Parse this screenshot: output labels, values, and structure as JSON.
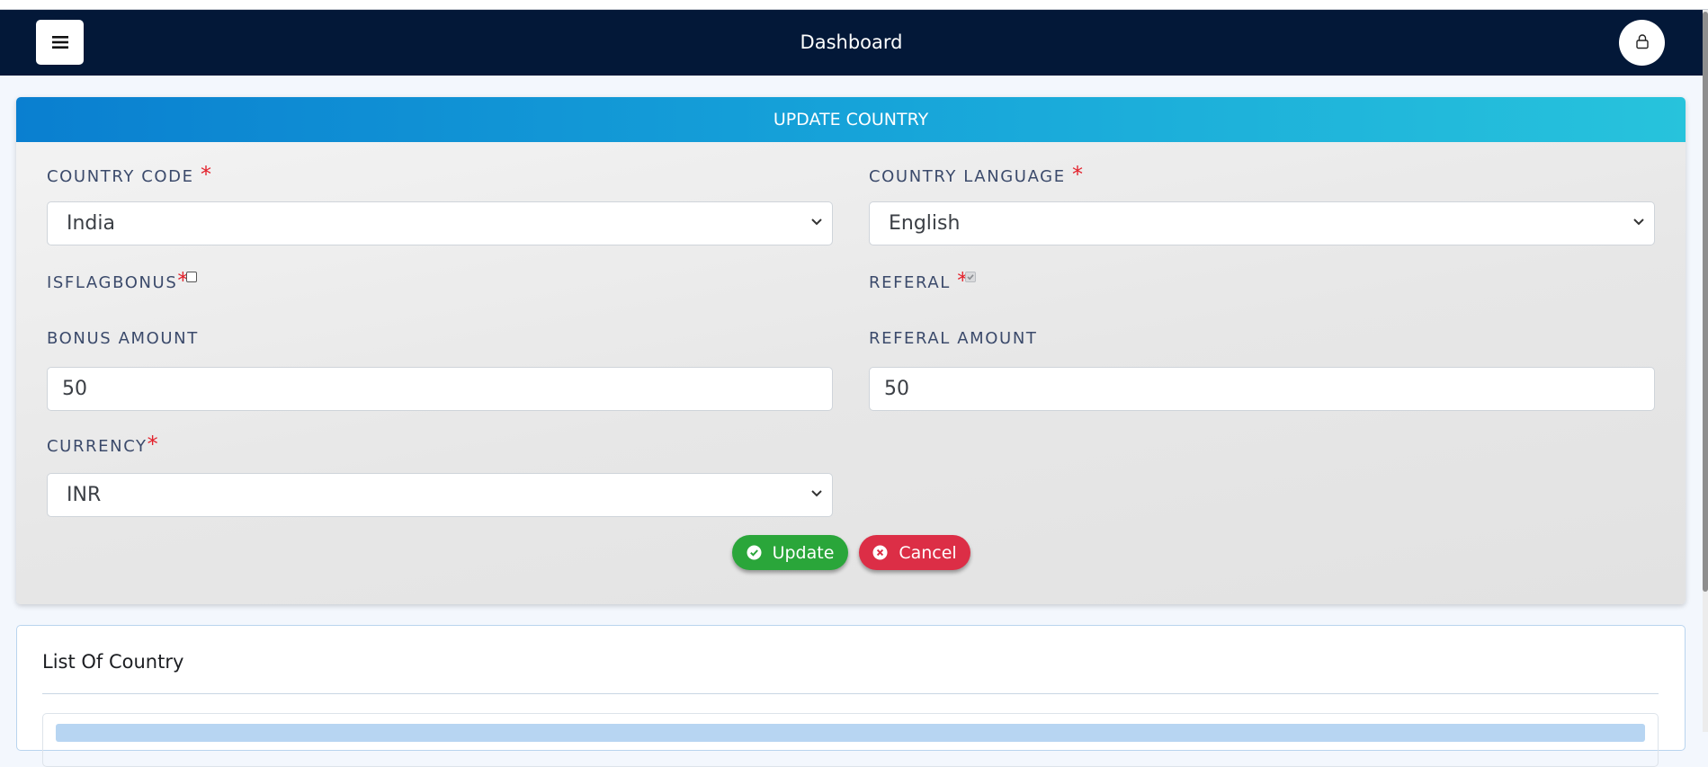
{
  "navbar": {
    "title": "Dashboard",
    "menu_icon": "hamburger-menu-icon",
    "user_icon": "user-lock-icon",
    "background": "#031838"
  },
  "form": {
    "header": "UPDATE COUNTRY",
    "country_code": {
      "label": "COUNTRY CODE",
      "required": "*",
      "selected": "India"
    },
    "country_language": {
      "label": "COUNTRY LANGUAGE",
      "required": "*",
      "selected": "English"
    },
    "isflagbonus": {
      "label": "ISFLAGBONUS",
      "required": "*",
      "checked": false
    },
    "referal": {
      "label": "REFERAL",
      "required": "*",
      "checked": true,
      "disabled": true
    },
    "bonus_amount": {
      "label": "BONUS AMOUNT",
      "value": "50"
    },
    "referal_amount": {
      "label": "REFERAL AMOUNT",
      "value": "50"
    },
    "currency": {
      "label": "CURRENCY",
      "required": "*",
      "selected": "INR"
    },
    "update_button": {
      "label": "Update",
      "icon": "check-circle-icon",
      "color": "#2aa63a"
    },
    "cancel_button": {
      "label": "Cancel",
      "icon": "times-circle-icon",
      "color": "#dc2e46"
    }
  },
  "list": {
    "title": "List Of Country"
  }
}
